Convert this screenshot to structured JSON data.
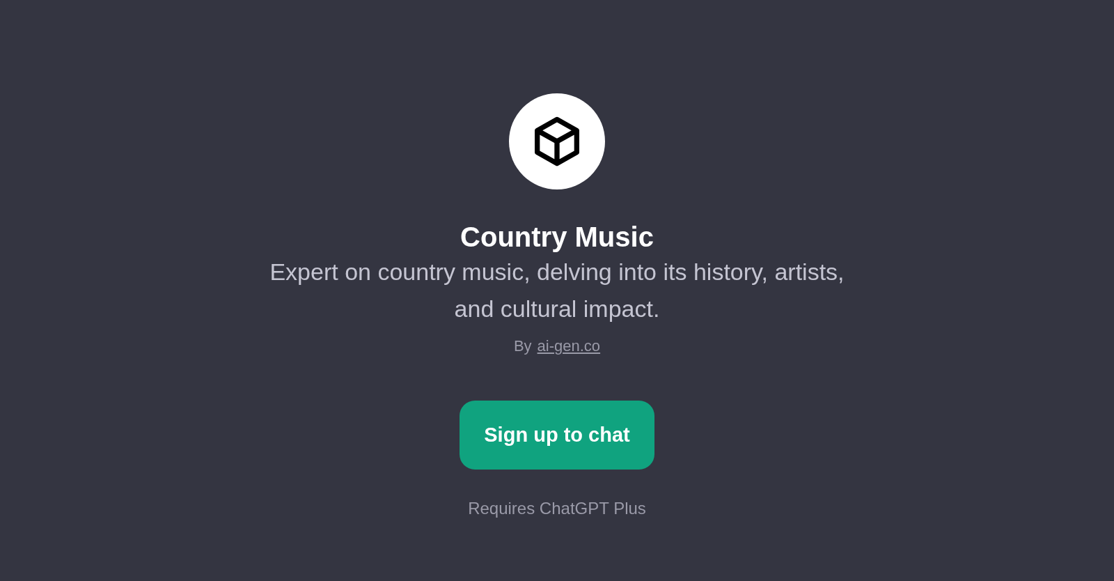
{
  "title": "Country Music",
  "description": "Expert on country music, delving into its history, artists, and cultural impact.",
  "byline": {
    "prefix": "By",
    "link": "ai-gen.co"
  },
  "button": {
    "label": "Sign up to chat"
  },
  "note": "Requires ChatGPT Plus"
}
